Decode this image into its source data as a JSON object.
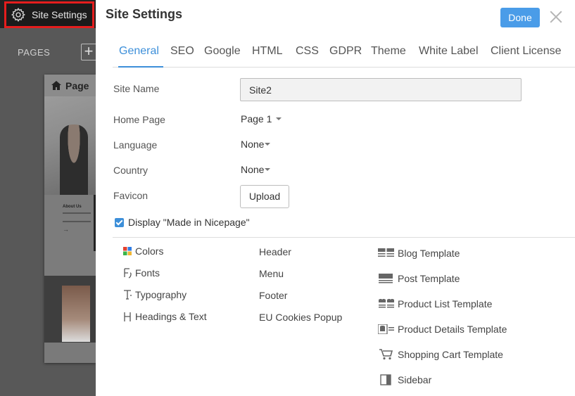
{
  "topbar": {
    "site_settings_label": "Site Settings"
  },
  "left_panel": {
    "pages_label": "PAGES",
    "add_symbol": "+",
    "page_card_title": "Page",
    "thumb_about_title": "About Us",
    "thumb_arrow": "→"
  },
  "modal": {
    "title": "Site Settings",
    "done_label": "Done",
    "tabs": [
      {
        "label": "General",
        "active": true
      },
      {
        "label": "SEO"
      },
      {
        "label": "Google"
      },
      {
        "label": "HTML"
      },
      {
        "label": "CSS"
      },
      {
        "label": "GDPR"
      },
      {
        "label": "Theme"
      },
      {
        "label": "White Label"
      },
      {
        "label": "Client License"
      }
    ],
    "form": {
      "site_name_label": "Site Name",
      "site_name_value": "Site2",
      "home_page_label": "Home Page",
      "home_page_value": "Page 1",
      "language_label": "Language",
      "language_value": "None",
      "country_label": "Country",
      "country_value": "None",
      "favicon_label": "Favicon",
      "upload_label": "Upload",
      "made_in_label": "Display \"Made in Nicepage\"",
      "made_in_checked": true
    },
    "col1": [
      {
        "label": "Colors",
        "icon": "colors-icon"
      },
      {
        "label": "Fonts",
        "icon": "fonts-icon"
      },
      {
        "label": "Typography",
        "icon": "typography-icon"
      },
      {
        "label": "Headings & Text",
        "icon": "headings-icon"
      }
    ],
    "col2": [
      {
        "label": "Header"
      },
      {
        "label": "Menu"
      },
      {
        "label": "Footer"
      },
      {
        "label": "EU Cookies Popup"
      }
    ],
    "col3": [
      {
        "label": "Blog Template",
        "icon": "blog-template-icon"
      },
      {
        "label": "Post Template",
        "icon": "post-template-icon"
      },
      {
        "label": "Product List Template",
        "icon": "product-list-icon"
      },
      {
        "label": "Product Details Template",
        "icon": "product-details-icon"
      },
      {
        "label": "Shopping Cart Template",
        "icon": "cart-icon"
      },
      {
        "label": "Sidebar",
        "icon": "sidebar-icon"
      }
    ]
  },
  "colors": {
    "accent": "#3d8fd9",
    "done_button": "#4a9ce8",
    "highlight_border": "#e51d1d"
  }
}
